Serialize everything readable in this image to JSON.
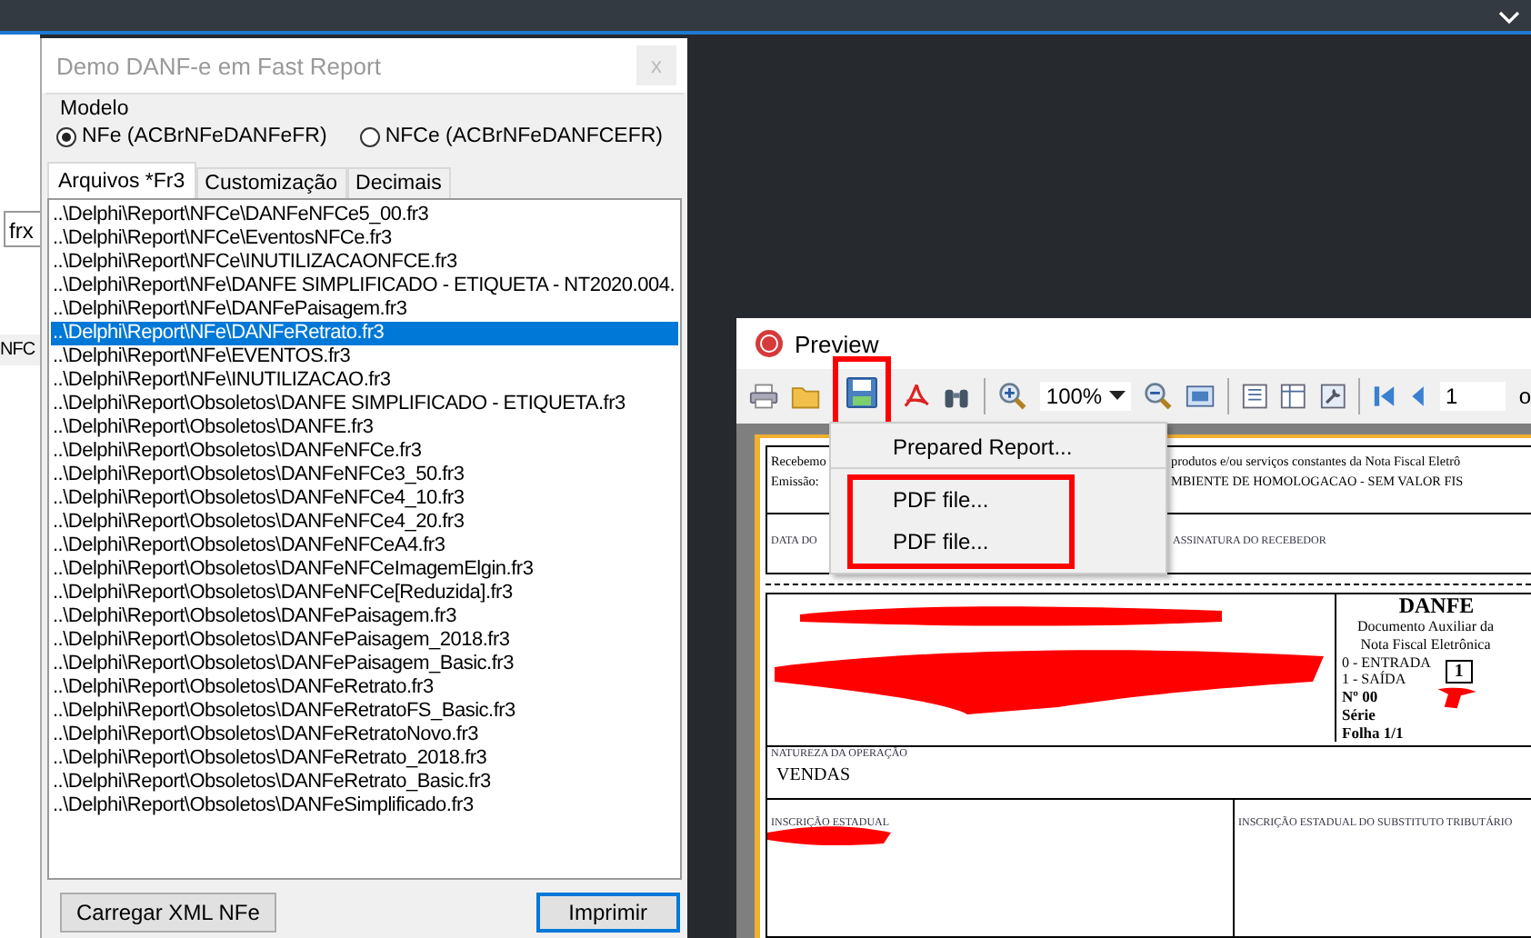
{
  "background_window": {
    "field_value": "frx",
    "label": "NFC"
  },
  "demo_window": {
    "title": "Demo DANF-e em Fast Report",
    "close": "x",
    "modelo": {
      "label": "Modelo",
      "options": [
        {
          "label": "NFe (ACBrNFeDANFeFR)",
          "selected": true
        },
        {
          "label": "NFCe (ACBrNFeDANFCEFR)",
          "selected": false
        }
      ]
    },
    "tabs": [
      {
        "label": "Arquivos *Fr3",
        "selected": true
      },
      {
        "label": "Customização",
        "selected": false
      },
      {
        "label": "Decimais",
        "selected": false
      }
    ],
    "files": [
      {
        "path": "..\\Delphi\\Report\\NFCe\\DANFeNFCe5_00.fr3",
        "selected": false
      },
      {
        "path": "..\\Delphi\\Report\\NFCe\\EventosNFCe.fr3",
        "selected": false
      },
      {
        "path": "..\\Delphi\\Report\\NFCe\\INUTILIZACAONFCE.fr3",
        "selected": false
      },
      {
        "path": "..\\Delphi\\Report\\NFe\\DANFE SIMPLIFICADO - ETIQUETA - NT2020.004.",
        "selected": false
      },
      {
        "path": "..\\Delphi\\Report\\NFe\\DANFePaisagem.fr3",
        "selected": false
      },
      {
        "path": "..\\Delphi\\Report\\NFe\\DANFeRetrato.fr3",
        "selected": true
      },
      {
        "path": "..\\Delphi\\Report\\NFe\\EVENTOS.fr3",
        "selected": false
      },
      {
        "path": "..\\Delphi\\Report\\NFe\\INUTILIZACAO.fr3",
        "selected": false
      },
      {
        "path": "..\\Delphi\\Report\\Obsoletos\\DANFE SIMPLIFICADO - ETIQUETA.fr3",
        "selected": false
      },
      {
        "path": "..\\Delphi\\Report\\Obsoletos\\DANFE.fr3",
        "selected": false
      },
      {
        "path": "..\\Delphi\\Report\\Obsoletos\\DANFeNFCe.fr3",
        "selected": false
      },
      {
        "path": "..\\Delphi\\Report\\Obsoletos\\DANFeNFCe3_50.fr3",
        "selected": false
      },
      {
        "path": "..\\Delphi\\Report\\Obsoletos\\DANFeNFCe4_10.fr3",
        "selected": false
      },
      {
        "path": "..\\Delphi\\Report\\Obsoletos\\DANFeNFCe4_20.fr3",
        "selected": false
      },
      {
        "path": "..\\Delphi\\Report\\Obsoletos\\DANFeNFCeA4.fr3",
        "selected": false
      },
      {
        "path": "..\\Delphi\\Report\\Obsoletos\\DANFeNFCeImagemElgin.fr3",
        "selected": false
      },
      {
        "path": "..\\Delphi\\Report\\Obsoletos\\DANFeNFCe[Reduzida].fr3",
        "selected": false
      },
      {
        "path": "..\\Delphi\\Report\\Obsoletos\\DANFePaisagem.fr3",
        "selected": false
      },
      {
        "path": "..\\Delphi\\Report\\Obsoletos\\DANFePaisagem_2018.fr3",
        "selected": false
      },
      {
        "path": "..\\Delphi\\Report\\Obsoletos\\DANFePaisagem_Basic.fr3",
        "selected": false
      },
      {
        "path": "..\\Delphi\\Report\\Obsoletos\\DANFeRetrato.fr3",
        "selected": false
      },
      {
        "path": "..\\Delphi\\Report\\Obsoletos\\DANFeRetratoFS_Basic.fr3",
        "selected": false
      },
      {
        "path": "..\\Delphi\\Report\\Obsoletos\\DANFeRetratoNovo.fr3",
        "selected": false
      },
      {
        "path": "..\\Delphi\\Report\\Obsoletos\\DANFeRetrato_2018.fr3",
        "selected": false
      },
      {
        "path": "..\\Delphi\\Report\\Obsoletos\\DANFeRetrato_Basic.fr3",
        "selected": false
      },
      {
        "path": "..\\Delphi\\Report\\Obsoletos\\DANFeSimplificado.fr3",
        "selected": false
      }
    ],
    "buttons": [
      {
        "label": "Carregar XML NFe",
        "default": false
      },
      {
        "label": "Imprimir",
        "default": true
      }
    ]
  },
  "preview_window": {
    "title": "Preview",
    "zoom": "100%",
    "page": "1",
    "page_of": "o",
    "save_menu": {
      "items": [
        {
          "label": "Prepared Report...",
          "separator_after": true
        },
        {
          "label": "PDF file...",
          "separator_after": false
        },
        {
          "label": "PDF file...",
          "separator_after": false
        }
      ]
    },
    "document": {
      "receipt": {
        "line_1_left": "Recebemo",
        "line_1_right": "produtos e/ou serviços constantes da Nota Fiscal Eletrô",
        "line_2_left": "Emissão:",
        "line_2_right": "MBIENTE DE HOMOLOGACAO - SEM VALOR FIS",
        "date_label": "DATA DO",
        "signature_label": "ASSINATURA DO RECEBEDOR"
      },
      "danfe": {
        "title": "DANFE",
        "subtitle": "Documento Auxiliar da Nota Fiscal Eletrônica",
        "entry": "0 - ENTRADA",
        "exit": "1 - SAÍDA",
        "type_code": "1",
        "number": "Nº 00",
        "series": "Série",
        "sheet": "Folha 1/1"
      },
      "nature": {
        "label": "NATUREZA DA OPERAÇÃO",
        "value": "VENDAS"
      },
      "registration": {
        "label": "INSCRIÇÃO ESTADUAL",
        "substitute_label": "INSCRIÇÃO ESTADUAL DO SUBSTITUTO TRIBUTÁRIO"
      }
    }
  }
}
